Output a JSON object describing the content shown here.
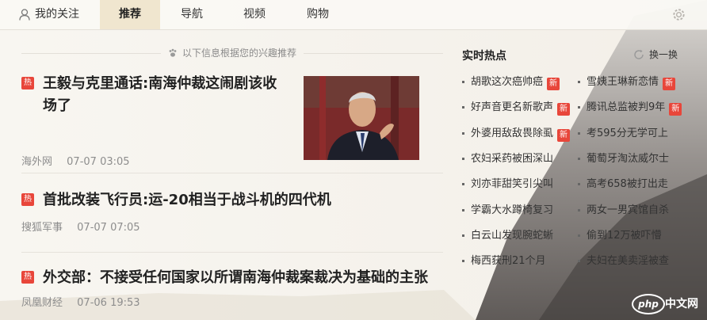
{
  "tabs": [
    {
      "label": "我的关注",
      "icon": "user-icon"
    },
    {
      "label": "推荐",
      "active": true
    },
    {
      "label": "导航"
    },
    {
      "label": "视频"
    },
    {
      "label": "购物"
    }
  ],
  "feed_hint": "以下信息根据您的兴趣推荐",
  "hot_tag_label": "热",
  "news": [
    {
      "title": "王毅与克里通话:南海仲裁这闹剧该收场了",
      "source": "海外网",
      "time": "07-07 03:05",
      "hot": true,
      "has_image": true
    },
    {
      "title": "首批改装飞行员:运-20相当于战斗机的四代机",
      "source": "搜狐军事",
      "time": "07-07 07:05",
      "hot": true
    },
    {
      "title": "外交部：不接受任何国家以所谓南海仲裁案裁决为基础的主张",
      "source": "凤凰财经",
      "time": "07-06 19:53",
      "hot": true
    }
  ],
  "hot_list": {
    "title": "实时热点",
    "refresh_label": "换一换",
    "new_badge": "新",
    "left": [
      {
        "text": "胡歌这次癌帅癌",
        "is_new": true
      },
      {
        "text": "好声音更名新歌声",
        "is_new": true
      },
      {
        "text": "外婆用敌敌畏除虱",
        "is_new": true
      },
      {
        "text": "农妇采药被困深山",
        "is_new": false
      },
      {
        "text": "刘亦菲甜笑引尖叫",
        "is_new": false
      },
      {
        "text": "学霸大水蹲椅复习",
        "is_new": false
      },
      {
        "text": "白云山发现腕蛇蜥",
        "is_new": false
      },
      {
        "text": "梅西获刑21个月",
        "is_new": false
      }
    ],
    "right": [
      {
        "text": "雪姨王琳新恋情",
        "is_new": true
      },
      {
        "text": "腾讯总监被判9年",
        "is_new": true
      },
      {
        "text": "考595分无学可上",
        "is_new": false
      },
      {
        "text": "葡萄牙淘汰威尔士",
        "is_new": false
      },
      {
        "text": "高考658被打出走",
        "is_new": false
      },
      {
        "text": "两女一男宾馆自杀",
        "is_new": false
      },
      {
        "text": "偷到12万被吓懵",
        "is_new": false
      },
      {
        "text": "夫妇在美卖淫被查",
        "is_new": false
      }
    ]
  },
  "watermark": {
    "logo": "php",
    "site": "中文网"
  },
  "colors": {
    "accent_red": "#e8463a",
    "active_tab_bg": "#f0e6cf"
  }
}
